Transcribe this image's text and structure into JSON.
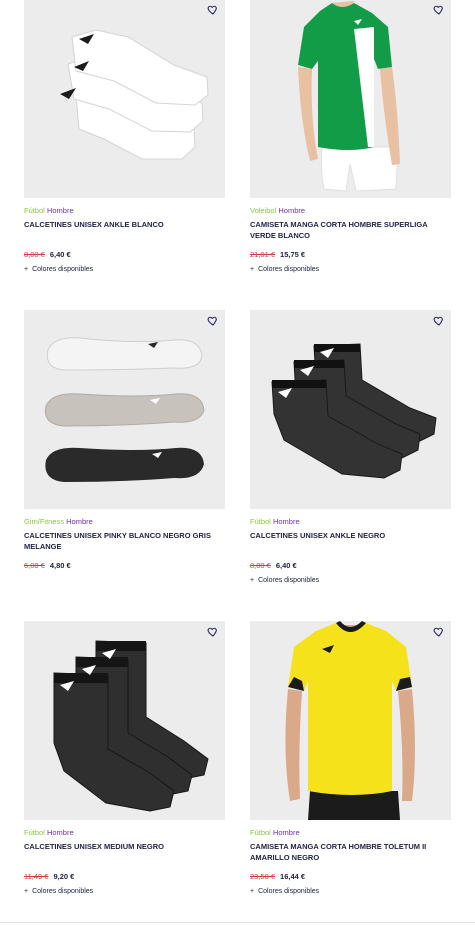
{
  "products": [
    {
      "sport": "Fútbol",
      "gender": "Hombre",
      "title": "CALCETINES UNISEX ANKLE BLANCO",
      "old_price": "8,00 €",
      "new_price": "6,40 €",
      "colors_label": "Colores disponibles",
      "wishlist_icon": "heart-outline-icon"
    },
    {
      "sport": "Voleibol",
      "gender": "Hombre",
      "title": "CAMISETA MANGA CORTA HOMBRE SUPERLIGA VERDE BLANCO",
      "old_price": "21,01 €",
      "new_price": "15,75 €",
      "colors_label": "Colores disponibles",
      "wishlist_icon": "heart-outline-icon"
    },
    {
      "sport": "Gim/Fitness",
      "gender": "Hombre",
      "title": "CALCETINES UNISEX PINKY BLANCO NEGRO GRIS MELANGE",
      "old_price": "6,00 €",
      "new_price": "4,80 €",
      "colors_label": "",
      "wishlist_icon": "heart-outline-icon"
    },
    {
      "sport": "Fútbol",
      "gender": "Hombre",
      "title": "CALCETINES UNISEX ANKLE NEGRO",
      "old_price": "8,00 €",
      "new_price": "6,40 €",
      "colors_label": "Colores disponibles",
      "wishlist_icon": "heart-outline-icon"
    },
    {
      "sport": "Fútbol",
      "gender": "Hombre",
      "title": "CALCETINES UNISEX MEDIUM NEGRO",
      "old_price": "11,49 €",
      "new_price": "9,20 €",
      "colors_label": "Colores disponibles",
      "wishlist_icon": "heart-outline-icon"
    },
    {
      "sport": "Fútbol",
      "gender": "Hombre",
      "title": "CAMISETA MANGA CORTA HOMBRE TOLETUM II AMARILLO NEGRO",
      "old_price": "23,50 €",
      "new_price": "16,44 €",
      "colors_label": "Colores disponibles",
      "wishlist_icon": "heart-outline-icon"
    }
  ],
  "colors": {
    "sport": "#8cc63f",
    "gender": "#6b2fb3",
    "old_price": "#d63b3b",
    "text": "#23234b"
  }
}
